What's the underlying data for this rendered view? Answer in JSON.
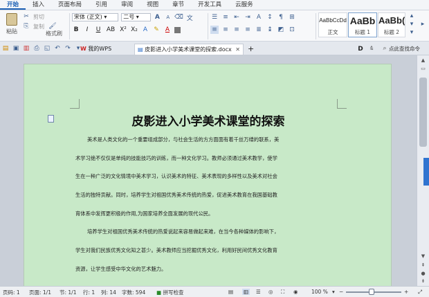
{
  "menu_tabs": [
    "开始",
    "插入",
    "页面布局",
    "引用",
    "审阅",
    "视图",
    "章节",
    "开发工具",
    "云服务"
  ],
  "ribbon": {
    "paste_label": "粘贴",
    "cut_label": "剪切",
    "copy_label": "复制",
    "format_painter_label": "格式刷",
    "font_name": "宋体 (正文)",
    "font_size": "二号",
    "styles": [
      {
        "preview": "AaBbCcDd",
        "label": "正文"
      },
      {
        "preview": "AaBb",
        "label": "标题 1"
      },
      {
        "preview": "AaBb(",
        "label": "标题 2"
      }
    ]
  },
  "doc_tabs": {
    "home_tab": "我的WPS",
    "doc_tab": "皮影进入小学美术课堂的探索.docx",
    "search_placeholder": "点此查找命令"
  },
  "document": {
    "title": "皮影进入小学美术课堂的探索",
    "lines": [
      {
        "text": "美术是人类文化的一个重要组成部分，与社会生活的方方面面有着千丝万缕的联系，美",
        "indent": true
      },
      {
        "text": "术学习绝不仅仅是单纯的技能技巧的训练，而一种文化学习。教师必须通过美术教学，使学",
        "indent": false
      },
      {
        "text": "生在一种广泛的文化情境中美术学习，认识美术的特征、美术表现的多样性以及美术对社会",
        "indent": false
      },
      {
        "text": "生活的独特贡献。同时，培养学生对祖国优秀美术传统的热爱，促进美术教育在我国基础教",
        "indent": false
      },
      {
        "text": "育体系中发挥更积极的作用,为国家培养全面发展的现代公民。",
        "indent": false
      },
      {
        "text": "培养学生对祖国优秀美术传统的热爱说起来容易做起来难，在当今各种媒体的影响下，",
        "indent": true
      },
      {
        "text": "学生对我们民族优秀文化知之甚少。美术教师应当挖掘优秀文化，利用好民间优秀文化教育",
        "indent": false
      },
      {
        "text": "资源，让学生感受中华文化的艺术魅力。",
        "indent": false
      }
    ]
  },
  "status": {
    "page": "页码: 1",
    "pages": "页面: 1/1",
    "section": "节: 1/1",
    "row": "行: 1",
    "col": "列: 14",
    "words": "字数: 594",
    "spell": "拼写检查",
    "zoom": "100 %"
  },
  "colors": {
    "accent": "#1a5fb4",
    "page_bg": "#c8e9c8"
  }
}
